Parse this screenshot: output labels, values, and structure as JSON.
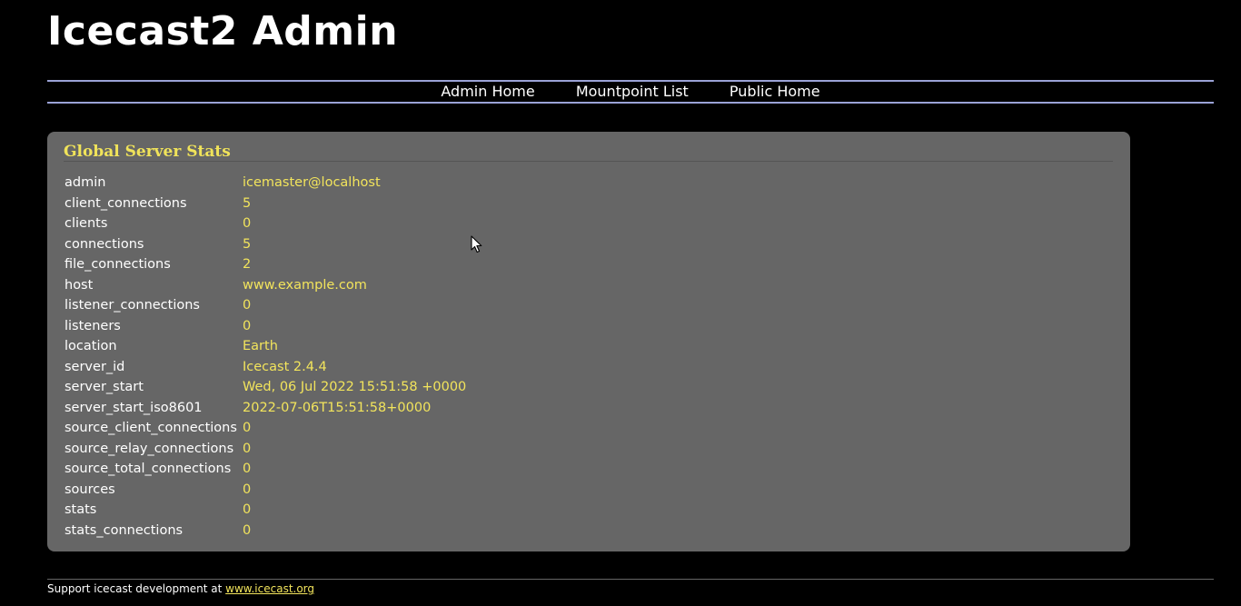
{
  "header": {
    "title": "Icecast2 Admin"
  },
  "nav": {
    "items": [
      {
        "label": "Admin Home"
      },
      {
        "label": "Mountpoint List"
      },
      {
        "label": "Public Home"
      }
    ]
  },
  "panel": {
    "title": "Global Server Stats",
    "stats": [
      {
        "key": "admin",
        "value": "icemaster@localhost"
      },
      {
        "key": "client_connections",
        "value": "5"
      },
      {
        "key": "clients",
        "value": "0"
      },
      {
        "key": "connections",
        "value": "5"
      },
      {
        "key": "file_connections",
        "value": "2"
      },
      {
        "key": "host",
        "value": "www.example.com"
      },
      {
        "key": "listener_connections",
        "value": "0"
      },
      {
        "key": "listeners",
        "value": "0"
      },
      {
        "key": "location",
        "value": "Earth"
      },
      {
        "key": "server_id",
        "value": "Icecast 2.4.4"
      },
      {
        "key": "server_start",
        "value": "Wed, 06 Jul 2022 15:51:58 +0000"
      },
      {
        "key": "server_start_iso8601",
        "value": "2022-07-06T15:51:58+0000"
      },
      {
        "key": "source_client_connections",
        "value": "0"
      },
      {
        "key": "source_relay_connections",
        "value": "0"
      },
      {
        "key": "source_total_connections",
        "value": "0"
      },
      {
        "key": "sources",
        "value": "0"
      },
      {
        "key": "stats",
        "value": "0"
      },
      {
        "key": "stats_connections",
        "value": "0"
      }
    ]
  },
  "footer": {
    "text": "Support icecast development at ",
    "link_label": "www.icecast.org"
  },
  "colors": {
    "background": "#000000",
    "panel": "#666666",
    "accent": "#f2e45c",
    "nav_rule": "#9aa2d6"
  },
  "icons": {
    "cursor": "mouse-pointer-icon"
  }
}
